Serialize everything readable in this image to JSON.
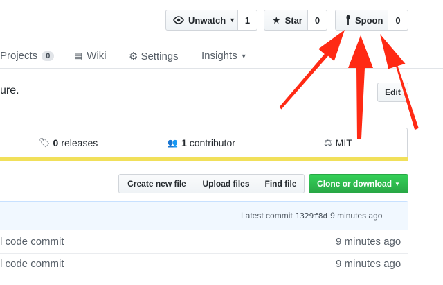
{
  "header": {
    "watch": {
      "label": "Unwatch",
      "count": "1"
    },
    "star": {
      "label": "Star",
      "count": "0"
    },
    "spoon": {
      "label": "Spoon",
      "count": "0"
    }
  },
  "tabs": [
    {
      "label": "Projects",
      "count": "0"
    },
    {
      "label": "Wiki"
    },
    {
      "label": "Settings"
    },
    {
      "label": "Insights"
    }
  ],
  "description": {
    "text": "ure.",
    "edit_label": "Edit"
  },
  "summary": {
    "releases_count": "0",
    "releases_label": "releases",
    "contributors_count": "1",
    "contributors_label": "contributor",
    "license": "MIT"
  },
  "file_actions": {
    "create": "Create new file",
    "upload": "Upload files",
    "find": "Find file",
    "clone": "Clone or download"
  },
  "commit_bar": {
    "prefix": "Latest commit",
    "sha": "1329f8d",
    "time": "9 minutes ago"
  },
  "files": [
    {
      "message": "l code commit",
      "age": "9 minutes ago"
    },
    {
      "message": "l code commit",
      "age": "9 minutes ago"
    }
  ],
  "colors": {
    "accent_bar": "#f1e05a",
    "clone_green": "#28a745",
    "arrow_red": "#ff2a14"
  }
}
